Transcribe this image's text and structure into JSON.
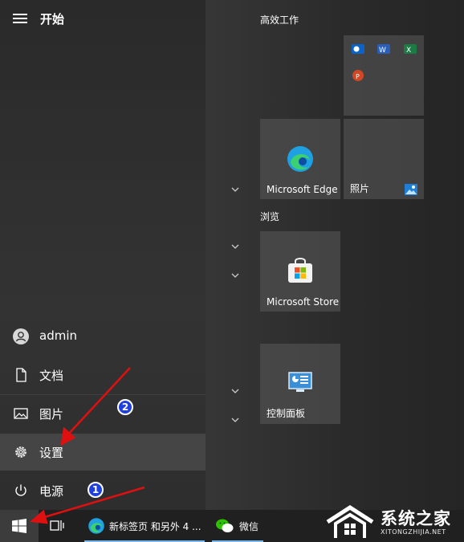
{
  "start": {
    "title": "开始"
  },
  "user": {
    "name": "admin"
  },
  "nav": {
    "documents": "文档",
    "pictures": "图片",
    "settings": "设置",
    "power": "电源"
  },
  "groups": {
    "productivity": "高效工作",
    "browse": "浏览"
  },
  "tiles": {
    "edge": "Microsoft Edge",
    "photos": "照片",
    "store": "Microsoft Store",
    "control_panel": "控制面板"
  },
  "taskbar": {
    "edge_app": "新标签页 和另外 4 ...",
    "wechat": "微信"
  },
  "annotations": {
    "one": "1",
    "two": "2"
  },
  "watermark": {
    "title": "系统之家",
    "subtitle": "XITONGZHIJIA.NET"
  },
  "colors": {
    "annotation": "#1f3fe0",
    "arrow": "#e01010",
    "accent": "#76b9ed"
  }
}
